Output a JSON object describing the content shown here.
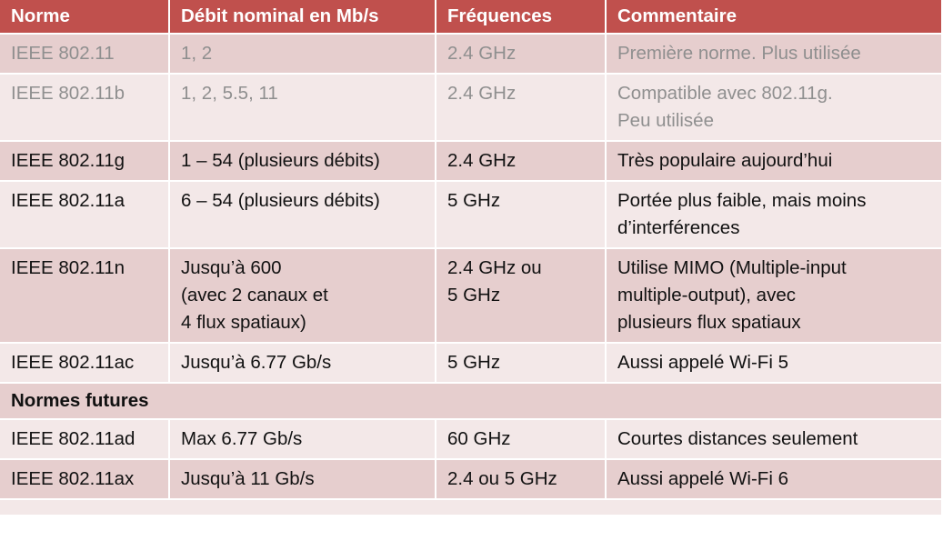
{
  "table": {
    "headers": [
      "Norme",
      "Débit nominal en Mb/s",
      "Fréquences",
      "Commentaire"
    ],
    "rows": [
      {
        "status": "obsolete",
        "norme": "IEEE 802.11",
        "debit": [
          "1, 2"
        ],
        "frequences": [
          "2.4 GHz"
        ],
        "commentaire": [
          "Première norme. Plus utilisée"
        ]
      },
      {
        "status": "obsolete",
        "norme": "IEEE 802.11b",
        "debit": [
          "1, 2, 5.5, 11"
        ],
        "frequences": [
          "2.4 GHz"
        ],
        "commentaire": [
          "Compatible avec 802.11g.",
          "Peu utilisée"
        ]
      },
      {
        "status": "current",
        "norme": "IEEE 802.11g",
        "debit": [
          "1 – 54 (plusieurs débits)"
        ],
        "frequences": [
          "2.4 GHz"
        ],
        "commentaire": [
          "Très populaire aujourd’hui"
        ]
      },
      {
        "status": "current",
        "norme": "IEEE 802.11a",
        "debit": [
          "6 – 54 (plusieurs débits)"
        ],
        "frequences": [
          "5 GHz"
        ],
        "commentaire": [
          "Portée plus faible, mais moins",
          "d’interférences"
        ]
      },
      {
        "status": "current",
        "norme": "IEEE 802.11n",
        "debit": [
          "Jusqu’à 600",
          "(avec 2 canaux et",
          "4 flux spatiaux)"
        ],
        "frequences": [
          "2.4 GHz ou",
          "5 GHz"
        ],
        "commentaire": [
          "Utilise MIMO (Multiple-input",
          "multiple-output), avec",
          "plusieurs flux spatiaux"
        ]
      },
      {
        "status": "current",
        "norme": "IEEE 802.11ac",
        "debit": [
          "Jusqu’à 6.77 Gb/s"
        ],
        "frequences": [
          "5 GHz"
        ],
        "commentaire": [
          "Aussi appelé Wi-Fi 5"
        ]
      }
    ],
    "section_label": "Normes futures",
    "future_rows": [
      {
        "status": "current",
        "norme": "IEEE 802.11ad",
        "debit": [
          "Max 6.77 Gb/s"
        ],
        "frequences": [
          "60 GHz"
        ],
        "commentaire": [
          "Courtes distances seulement"
        ]
      },
      {
        "status": "current",
        "norme": "IEEE 802.11ax",
        "debit": [
          "Jusqu’à 11 Gb/s"
        ],
        "frequences": [
          "2.4 ou 5 GHz"
        ],
        "commentaire": [
          "Aussi appelé Wi-Fi 6"
        ]
      }
    ]
  },
  "colors": {
    "header_bg": "#c0504d",
    "band_dark": "#e6cece",
    "band_light": "#f3e8e8",
    "obsolete_text": "#8f8f8f"
  }
}
